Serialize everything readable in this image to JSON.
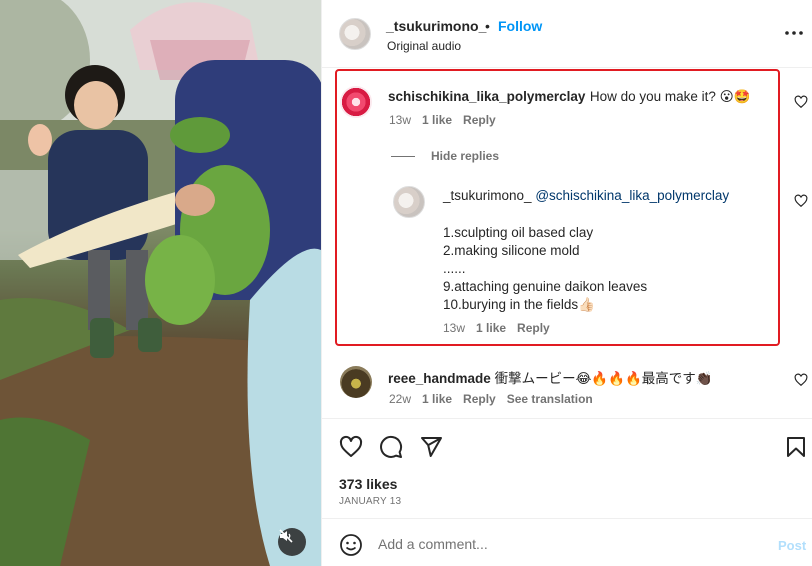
{
  "post": {
    "username": "_tsukurimono_",
    "dot": "•",
    "follow_label": "Follow",
    "audio": "Original audio",
    "more_icon": "more-horizontal-icon"
  },
  "comments": [
    {
      "username": "schischikina_lika_polymerclay",
      "text": "How do you make it? 😮🤩",
      "age": "13w",
      "likes": "1 like",
      "reply_label": "Reply",
      "hide_replies_label": "Hide replies",
      "replies": [
        {
          "username": "_tsukurimono_",
          "mention": "@schischikina_lika_polymerclay",
          "lines": [
            "1.sculpting oil based clay",
            "2.making silicone mold",
            "......",
            "9.attaching genuine daikon leaves",
            "10.burying in the fields👍🏻"
          ],
          "age": "13w",
          "likes": "1 like",
          "reply_label": "Reply"
        }
      ]
    },
    {
      "username": "reee_handmade",
      "text": "衝撃ムービー😂🔥🔥🔥最高です👏🏿",
      "age": "22w",
      "likes": "1 like",
      "reply_label": "Reply",
      "translate_label": "See translation"
    }
  ],
  "actions": {
    "like_icon": "heart-icon",
    "comment_icon": "comment-icon",
    "share_icon": "share-icon",
    "save_icon": "bookmark-icon",
    "likes_count": "373 likes",
    "date": "JANUARY 13"
  },
  "add_comment": {
    "placeholder": "Add a comment...",
    "post_label": "Post"
  },
  "colors": {
    "follow": "#0095f6",
    "highlight": "#e11b22",
    "mention": "#00376b",
    "post_disabled": "#b2dffc"
  }
}
